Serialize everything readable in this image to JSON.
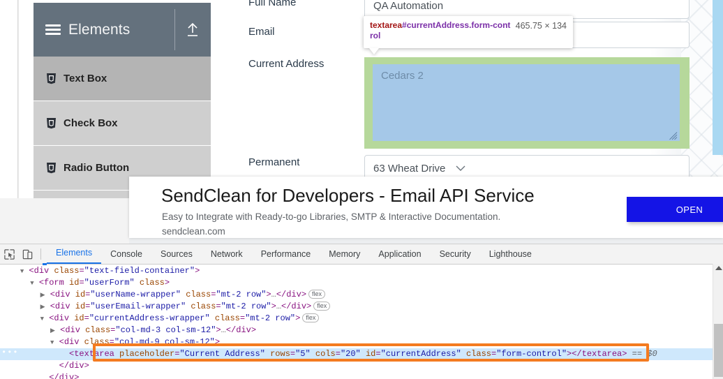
{
  "site": {
    "nav": {
      "header_title": "Elements",
      "menu_icon": "hamburger-icon",
      "upload_icon": "upload-arrow-icon",
      "items": [
        {
          "label": "Text Box",
          "icon": "html5-shield-icon",
          "active": true
        },
        {
          "label": "Check Box",
          "icon": "html5-shield-icon",
          "active": false
        },
        {
          "label": "Radio Button",
          "icon": "html5-shield-icon",
          "active": false
        }
      ]
    },
    "form": {
      "labels": {
        "full_name": "Full Name",
        "email": "Email",
        "current_address": "Current Address",
        "permanent_address": "Permanent"
      },
      "full_name_value": "QA Automation",
      "email_value": "",
      "current_address_placeholder": "Cedars 2",
      "permanent_address_value": "63 Wheat Drive",
      "permanent_caret_icon": "chevron-down-icon"
    }
  },
  "inspect_tooltip": {
    "tag": "textarea",
    "selector_id": "#currentAddress",
    "selector_class": ".form-control",
    "dimensions": "465.75 × 134"
  },
  "ad": {
    "title": "SendClean for Developers - Email API Service",
    "subtitle": "Easy to Integrate with Ready-to-go Libraries, SMTP & Interactive Documentation.",
    "url": "sendclean.com",
    "button_label": "OPEN",
    "button_color": "#1414e6"
  },
  "devtools": {
    "toolbar": {
      "inspect_icon": "inspect-element-icon",
      "device_toggle_icon": "device-toolbar-icon"
    },
    "tabs": [
      {
        "label": "Elements",
        "active": true
      },
      {
        "label": "Console",
        "active": false
      },
      {
        "label": "Sources",
        "active": false
      },
      {
        "label": "Network",
        "active": false
      },
      {
        "label": "Performance",
        "active": false
      },
      {
        "label": "Memory",
        "active": false
      },
      {
        "label": "Application",
        "active": false
      },
      {
        "label": "Security",
        "active": false
      },
      {
        "label": "Lighthouse",
        "active": false
      }
    ],
    "dom_lines": [
      {
        "indent": 2,
        "twisty": "open",
        "text": "<div class=\"text-field-container\">",
        "badge": "",
        "selected": false
      },
      {
        "indent": 3,
        "twisty": "open",
        "text": "<form id=\"userForm\" class>",
        "badge": "",
        "selected": false
      },
      {
        "indent": 4,
        "twisty": "closed",
        "text": "<div id=\"userName-wrapper\" class=\"mt-2 row\">…</div>",
        "badge": "flex",
        "selected": false
      },
      {
        "indent": 4,
        "twisty": "closed",
        "text": "<div id=\"userEmail-wrapper\" class=\"mt-2 row\">…</div>",
        "badge": "flex",
        "selected": false
      },
      {
        "indent": 4,
        "twisty": "open",
        "text": "<div id=\"currentAddress-wrapper\" class=\"mt-2 row\">",
        "badge": "flex",
        "selected": false
      },
      {
        "indent": 5,
        "twisty": "closed",
        "text": "<div class=\"col-md-3 col-sm-12\">…</div>",
        "badge": "",
        "selected": false
      },
      {
        "indent": 5,
        "twisty": "open",
        "text": "<div class=\"col-md-9 col-sm-12\">",
        "badge": "",
        "selected": false
      },
      {
        "indent": 6,
        "twisty": "none",
        "text": "<textarea placeholder=\"Current Address\" rows=\"5\" cols=\"20\" id=\"currentAddress\" class=\"form-control\"></textarea> == $0",
        "badge": "",
        "selected": true
      },
      {
        "indent": 5,
        "twisty": "none",
        "text": "</div>",
        "badge": "",
        "selected": false
      },
      {
        "indent": 4,
        "twisty": "none",
        "text": "</div>",
        "badge": "",
        "selected": false
      }
    ],
    "selected_row_ellipsis": "•••",
    "highlight_color": "#f47b20"
  }
}
